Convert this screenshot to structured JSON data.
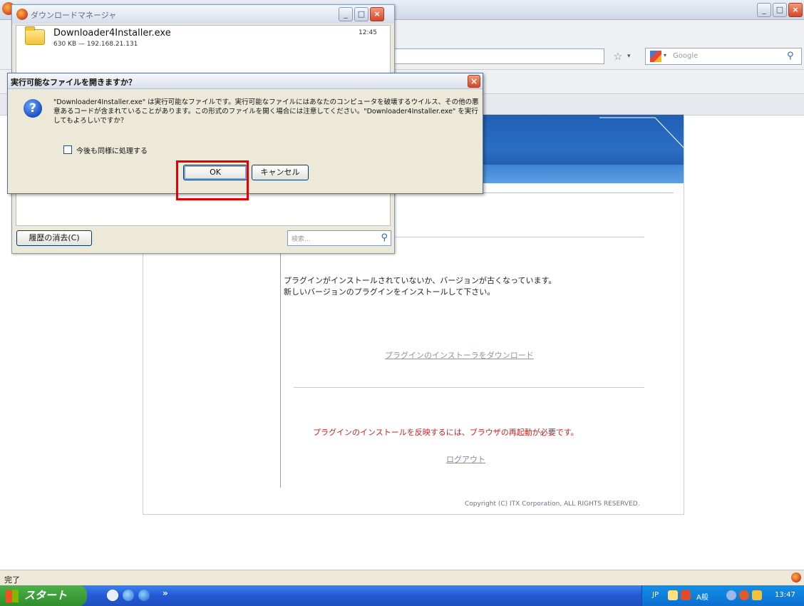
{
  "browser": {
    "title": "",
    "search_placeholder": "Google"
  },
  "download_manager": {
    "title": "ダウンロードマネージャ",
    "item": {
      "filename": "Downloader4Installer.exe",
      "info": "630 KB — 192.168.21.131",
      "time": "12:45"
    },
    "clear_button": "履歴の消去(C)",
    "search_placeholder": "検索..."
  },
  "dialog": {
    "title": "実行可能なファイルを開きますか？",
    "message": "\"Downloader4Installer.exe\" は実行可能なファイルです。実行可能なファイルにはあなたのコンピュータを破壊するウイルス、その他の悪意あるコードが含まれていることがあります。この形式のファイルを開く場合には注意してください。\"Downloader4Installer.exe\" を実行してもよろしいですか？",
    "checkbox_label": "今後も同様に処理する",
    "ok_label": "OK",
    "cancel_label": "キャンセル"
  },
  "page": {
    "message_line1": "プラグインがインストールされていないか、バージョンが古くなっています。",
    "message_line2": "新しいバージョンのプラグインをインストールして下さい。",
    "download_link": "プラグインのインストーラをダウンロード",
    "restart_message": "プラグインのインストールを反映するには、ブラウザの再起動が必要です。",
    "logout_link": "ログアウト",
    "copyright": "Copyright (C) ITX Corporation, ALL RIGHTS RESERVED."
  },
  "statusbar": {
    "text": "完了"
  },
  "taskbar": {
    "start_label": "スタート",
    "quicklaunch_more": "»",
    "tray_lang": "JP",
    "tray_ime": "A般",
    "clock": "13:47"
  },
  "colors": {
    "highlight_box": "#e60000",
    "banner_blue": "#2a6fc5",
    "restart_text": "#c42020",
    "taskbar_blue": "#2559d4",
    "start_green": "#2e8f2c"
  }
}
